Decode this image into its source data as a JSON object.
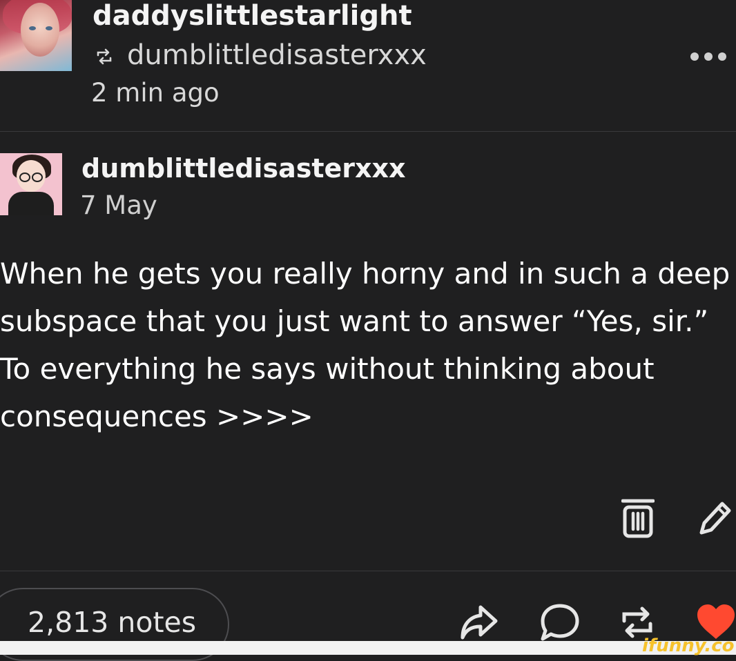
{
  "reblog_header": {
    "username": "daddyslittlestarlight",
    "reblogged_from": "dumblittledisasterxxx",
    "time": "2 min ago"
  },
  "post": {
    "author": "dumblittledisasterxxx",
    "date": "7 May",
    "body": "When he gets you really horny and in such a deep\nsubspace that you just want to answer “Yes, sir.”\nTo everything he says without thinking about\nconsequences >>>>"
  },
  "footer": {
    "notes": "2,813 notes"
  },
  "watermark": "ifunny.co",
  "colors": {
    "background": "#1f1f20",
    "text": "#ffffff",
    "muted": "#d8d8d8",
    "like": "#ff4930",
    "watermark": "#f6c22c"
  },
  "icons": {
    "reblog_indicator": "reblog-icon",
    "more": "more-dots-icon",
    "delete": "trash-icon",
    "edit": "pencil-icon",
    "share": "share-arrow-icon",
    "reply": "speech-bubble-icon",
    "reblog": "reblog-icon",
    "like": "heart-icon"
  }
}
